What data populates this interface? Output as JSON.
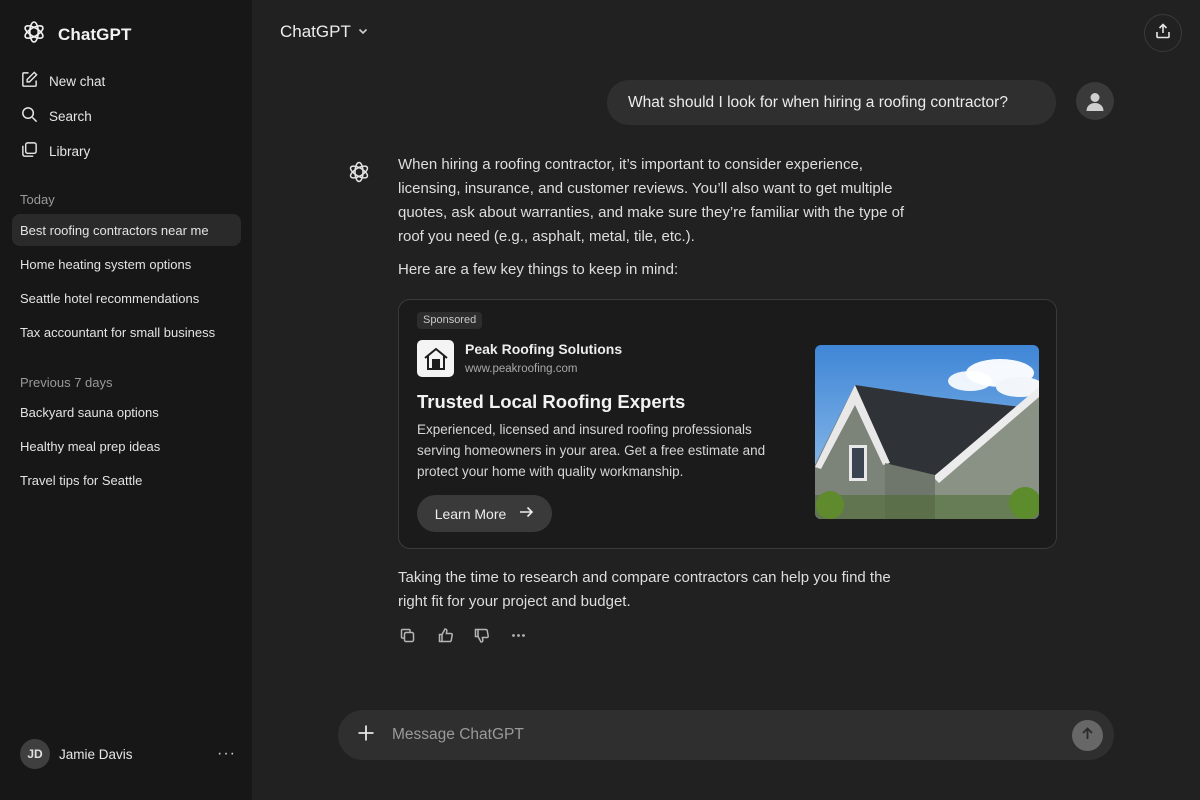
{
  "sidebar": {
    "brand": "ChatGPT",
    "nav": [
      {
        "label": "New chat",
        "icon": "new-chat-icon"
      },
      {
        "label": "Search",
        "icon": "search-icon"
      },
      {
        "label": "Library",
        "icon": "library-icon"
      }
    ],
    "today_label": "Today",
    "today": [
      {
        "label": "Best roofing contractors near me",
        "active": true
      },
      {
        "label": "Home heating system options"
      },
      {
        "label": "Seattle hotel recommendations"
      },
      {
        "label": "Tax accountant for small business"
      }
    ],
    "prev_label": "Previous 7 days",
    "previous": [
      {
        "label": "Backyard sauna options"
      },
      {
        "label": "Healthy meal prep ideas"
      },
      {
        "label": "Travel tips for Seattle"
      }
    ],
    "user": {
      "initials": "JD",
      "name": "Jamie Davis",
      "menu": "···"
    }
  },
  "header": {
    "model": "ChatGPT",
    "share_icon": "share-icon"
  },
  "conversation": {
    "user_message": "What should I look for when hiring a roofing contractor?",
    "answer_p1": "When hiring a roofing contractor, it’s important to consider experience, licensing, insurance, and customer reviews. You’ll also want to get multiple quotes, ask about warranties, and make sure they’re familiar with the type of roof you need (e.g., asphalt, metal, tile, etc.).",
    "answer_p2": "Here are a few key things to keep in mind:",
    "answer_p3": "Taking the time to research and compare contractors can help you find the right fit for your project and budget."
  },
  "ad": {
    "sponsored": "Sponsored",
    "advertiser": "Peak Roofing Solutions",
    "url": "www.peakroofing.com",
    "headline": "Trusted Local Roofing Experts",
    "body": "Experienced, licensed and insured roofing professionals serving homeowners in your area. Get a free estimate and protect your home with quality workmanship.",
    "cta": "Learn More"
  },
  "actions": [
    "copy-icon",
    "thumbs-up-icon",
    "thumbs-down-icon",
    "more-icon"
  ],
  "composer": {
    "placeholder": "Message ChatGPT"
  },
  "colors": {
    "background": "#212121",
    "sidebar": "#171717",
    "bubble": "#2f2f2f"
  }
}
